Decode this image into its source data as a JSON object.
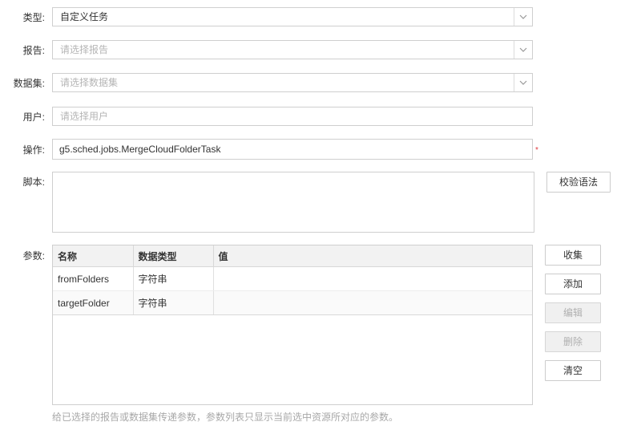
{
  "form": {
    "type": {
      "label": "类型:",
      "value": "自定义任务"
    },
    "report": {
      "label": "报告:",
      "placeholder": "请选择报告"
    },
    "dataset": {
      "label": "数据集:",
      "placeholder": "请选择数据集"
    },
    "user": {
      "label": "用户:",
      "placeholder": "请选择用户"
    },
    "action": {
      "label": "操作:",
      "value": "g5.sched.jobs.MergeCloudFolderTask",
      "required_mark": "*"
    },
    "script": {
      "label": "脚本:",
      "value": "",
      "validate_button": "校验语法"
    },
    "params": {
      "label": "参数:",
      "columns": [
        "名称",
        "数据类型",
        "值"
      ],
      "rows": [
        {
          "name": "fromFolders",
          "type": "字符串",
          "value": ""
        },
        {
          "name": "targetFolder",
          "type": "字符串",
          "value": ""
        }
      ],
      "buttons": {
        "collect": "收集",
        "add": "添加",
        "edit": "编辑",
        "delete": "删除",
        "clear": "清空"
      },
      "hint": "给已选择的报告或数据集传递参数，参数列表只显示当前选中资源所对应的参数。"
    }
  },
  "icons": {
    "dropdown": "chevron-down-icon"
  },
  "colors": {
    "required": "#e0393e",
    "border": "#cfcfcf",
    "header_bg": "#f2f2f2"
  }
}
